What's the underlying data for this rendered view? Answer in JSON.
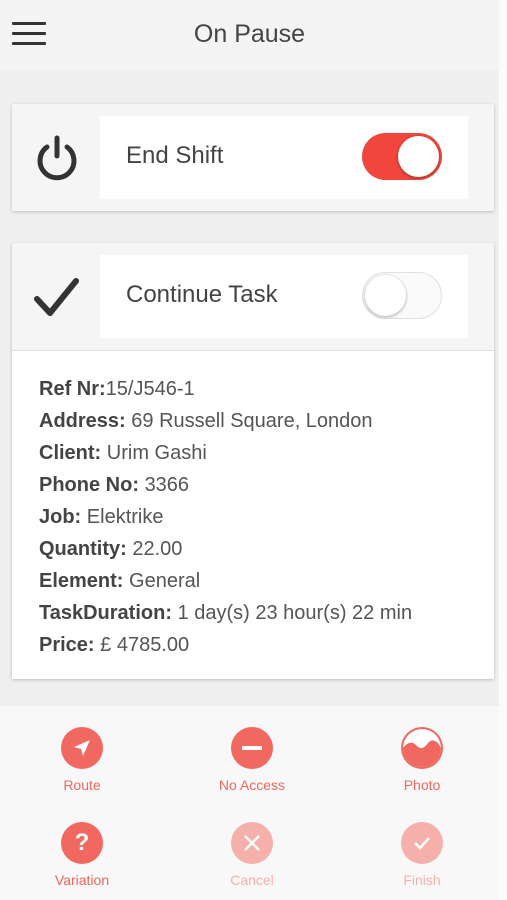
{
  "header": {
    "title": "On Pause",
    "menu_icon": "hamburger-icon"
  },
  "end_shift": {
    "label": "End Shift",
    "icon": "power-icon",
    "toggle_on": true
  },
  "continue_task": {
    "label": "Continue Task",
    "icon": "checkmark-icon",
    "toggle_on": false
  },
  "details": {
    "ref_label": "Ref Nr:",
    "ref_value": "15/J546-1",
    "address_label": "Address:",
    "address_value": "69 Russell Square, London",
    "client_label": "Client:",
    "client_value": "Urim Gashi",
    "phone_label": "Phone No:",
    "phone_value": "3366",
    "job_label": "Job:",
    "job_value": "Elektrike",
    "quantity_label": "Quantity:",
    "quantity_value": "22.00",
    "element_label": "Element:",
    "element_value": "General",
    "duration_label": "TaskDuration:",
    "duration_value": "1 day(s) 23 hour(s) 22 min",
    "price_label": "Price:",
    "price_value": "£ 4785.00"
  },
  "actions": {
    "route": "Route",
    "no_access": "No Access",
    "photo": "Photo",
    "variation": "Variation",
    "cancel": "Cancel",
    "finish": "Finish"
  },
  "colors": {
    "accent": "#f0463c",
    "action": "#f0685f",
    "action_disabled": "#f6b0ab"
  }
}
